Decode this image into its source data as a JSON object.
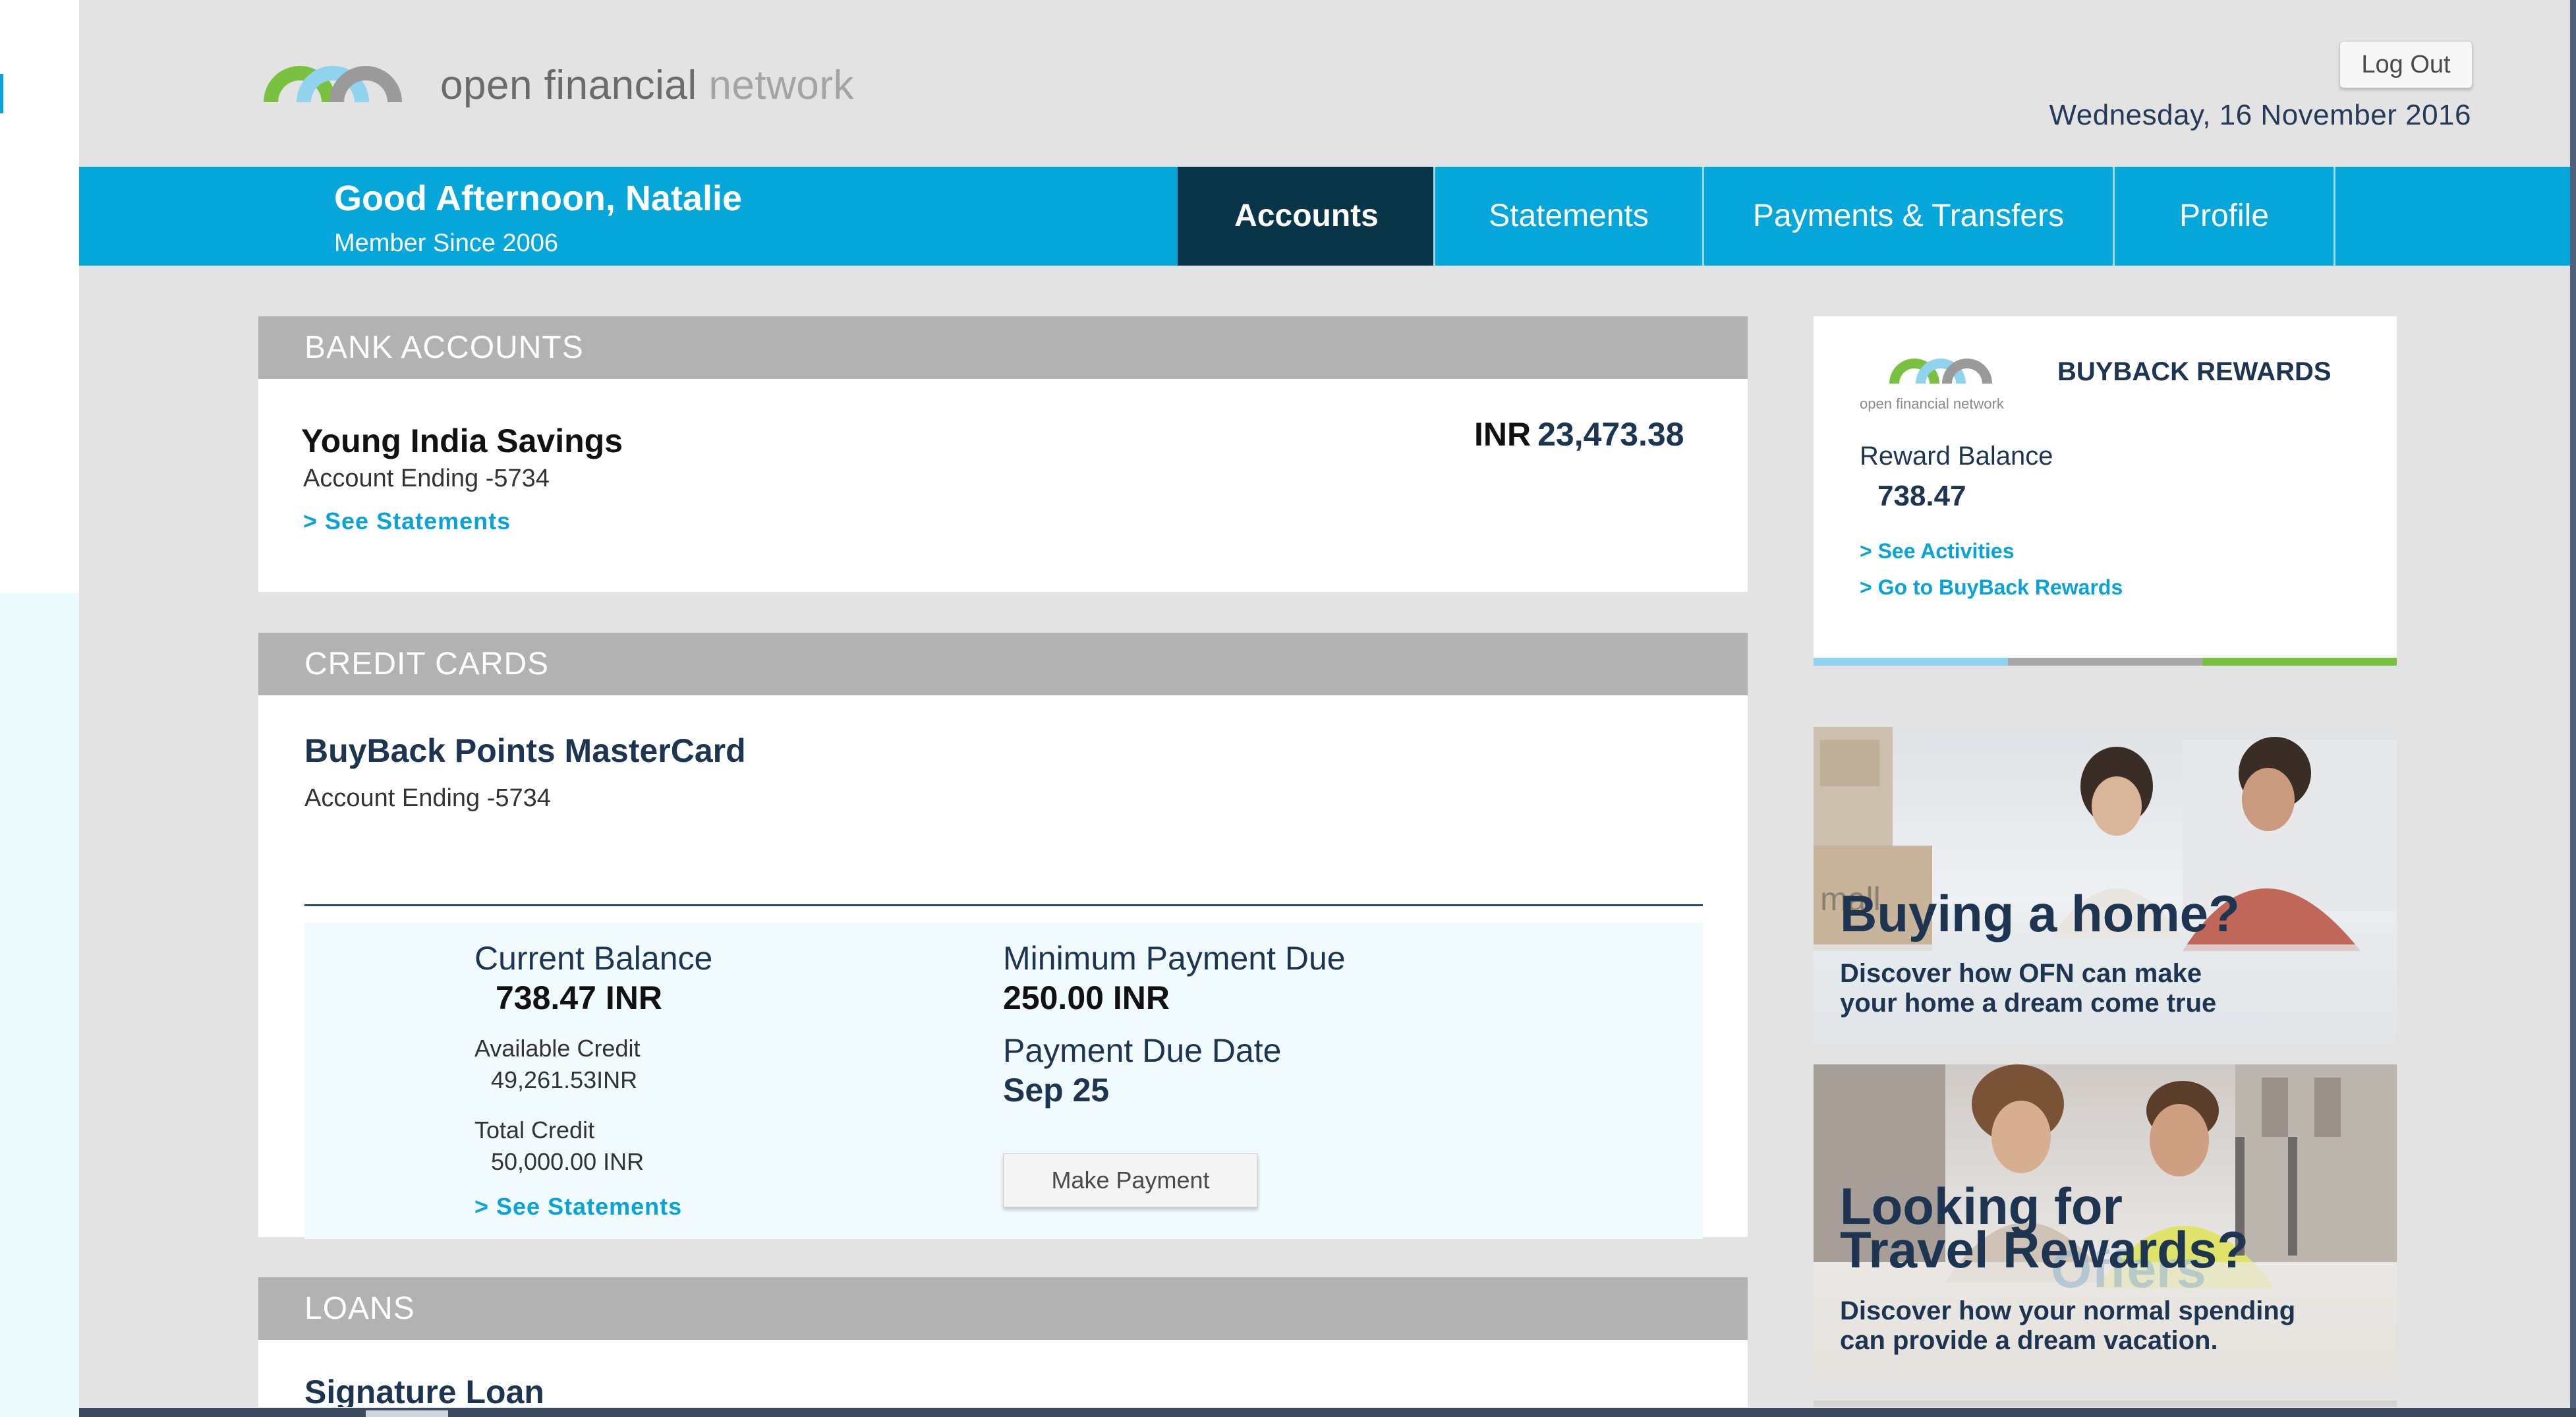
{
  "brand": {
    "name_main": "open financial",
    "name_light": "network"
  },
  "header": {
    "logout_label": "Log Out",
    "date": "Wednesday, 16 November 2016"
  },
  "greeting": {
    "title": "Good Afternoon, Natalie",
    "member": "Member Since 2006"
  },
  "nav": {
    "tabs": [
      {
        "label": "Accounts",
        "active": true
      },
      {
        "label": "Statements",
        "active": false
      },
      {
        "label": "Payments & Transfers",
        "active": false
      },
      {
        "label": "Profile",
        "active": false
      }
    ]
  },
  "bank": {
    "heading": "BANK ACCOUNTS",
    "name": "Young India Savings",
    "ending": "Account Ending -5734",
    "link": ">  See Statements",
    "currency": "INR",
    "balance": "23,473.38"
  },
  "credit": {
    "heading": "CREDIT CARDS",
    "name": "BuyBack Points MasterCard",
    "ending": "Account Ending -5734",
    "current_balance_label": "Current Balance",
    "current_balance_value": "738.47 INR",
    "available_credit_label": "Available Credit",
    "available_credit_value": "49,261.53INR",
    "total_credit_label": "Total Credit",
    "total_credit_value": "50,000.00 INR",
    "link": ">  See Statements",
    "min_payment_label": "Minimum Payment Due",
    "min_payment_value": "250.00 INR",
    "due_date_label": "Payment Due Date",
    "due_date_value": "Sep 25",
    "pay_button": "Make Payment"
  },
  "loans": {
    "heading": "LOANS",
    "name": "Signature Loan"
  },
  "rewards": {
    "logo_text": "open financial network",
    "title": "BUYBACK REWARDS",
    "balance_label": "Reward Balance",
    "balance_value": "738.47",
    "link_activities": ">   See Activities",
    "link_rewards": ">   Go to BuyBack Rewards",
    "bar_colors": [
      "#8fd3ee",
      "#a8a8a8",
      "#7ac142"
    ]
  },
  "promos": [
    {
      "title": "Buying a home?",
      "subtitle_1": "Discover how OFN can make",
      "subtitle_2": "your home a dream come true",
      "store_sign": "mall"
    },
    {
      "title_1": "Looking for",
      "title_2": "Travel Rewards?",
      "subtitle_1": "Discover how your normal spending",
      "subtitle_2": "can provide a dream vacation.",
      "sign": "Offers"
    }
  ],
  "colors": {
    "accent": "#05a6d9",
    "nav_active": "#083548",
    "text_dark": "#1d3550",
    "link": "#0aa3d8"
  }
}
